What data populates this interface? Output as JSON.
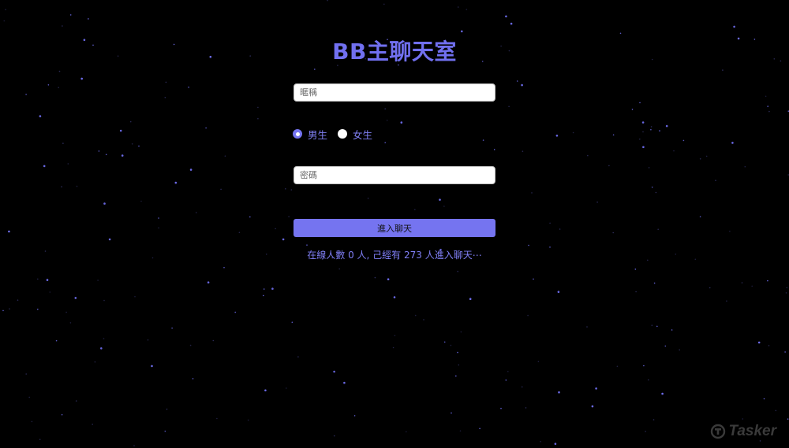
{
  "app": {
    "title": "BB主聊天室"
  },
  "form": {
    "nickname_placeholder": "暱稱",
    "gender_options": [
      {
        "label": "男生",
        "selected": true
      },
      {
        "label": "女生",
        "selected": false
      }
    ],
    "password_placeholder": "密碼",
    "submit_label": "進入聊天"
  },
  "status": {
    "text": "在線人數 0 人, 己經有 273 人進入聊天⋯"
  },
  "watermark": {
    "brand": "Tasker",
    "icon": "tasker-logo-icon"
  },
  "colors": {
    "background": "#000000",
    "accent": "#7574f0",
    "star": "#6f6ef0"
  }
}
